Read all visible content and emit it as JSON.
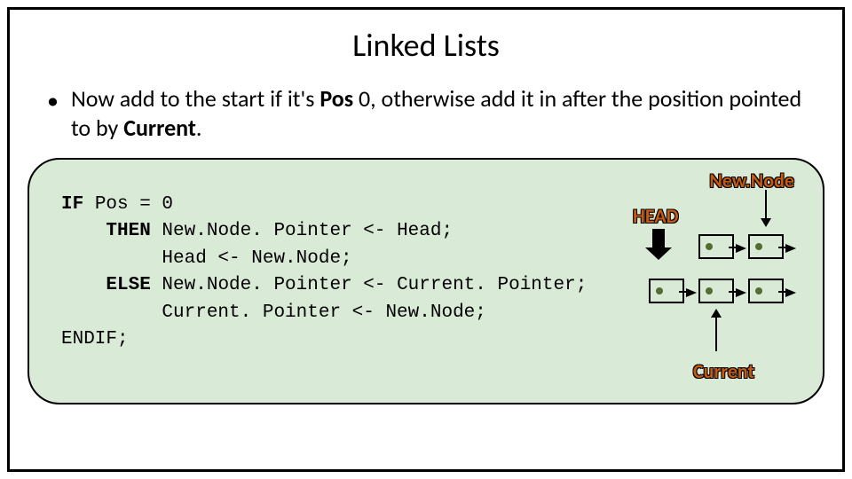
{
  "title": "Linked Lists",
  "bullet": {
    "prefix": "Now add to the start if it's ",
    "bold1": "Pos",
    "mid": " 0, otherwise add it in after the position pointed to by ",
    "bold2": "Current",
    "suffix": "."
  },
  "labels": {
    "newNode": "New.Node",
    "head": "HEAD",
    "current": "Current"
  },
  "code": {
    "l1a": "IF",
    "l1b": " Pos = 0",
    "l2a": "    THEN",
    "l2b": " New.Node. Pointer <- Head;",
    "l3": "         Head <- New.Node;",
    "l4a": "    ELSE",
    "l4b": " New.Node. Pointer <- Current. Pointer;",
    "l5": "         Current. Pointer <- New.Node;",
    "l6": "ENDIF;"
  }
}
